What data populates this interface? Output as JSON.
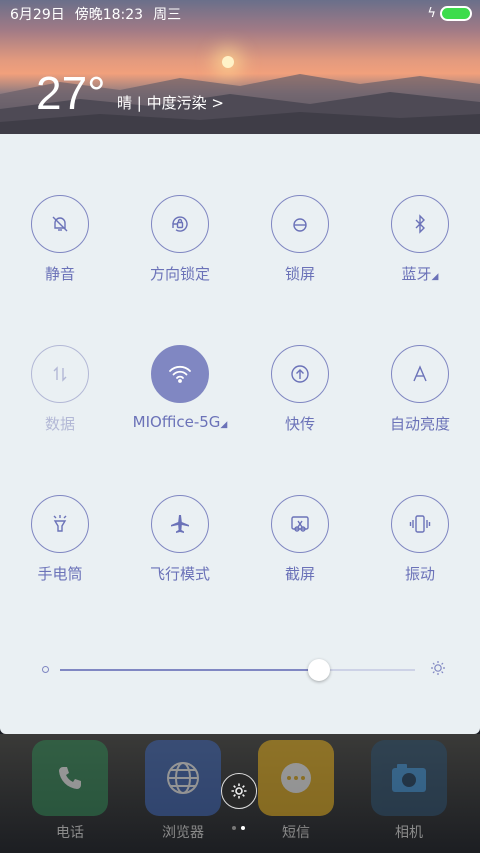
{
  "status": {
    "date": "6月29日",
    "time": "傍晚18:23",
    "weekday": "周三"
  },
  "weather": {
    "temp": "27°",
    "desc": "晴 | 中度污染 >"
  },
  "toggles": [
    {
      "label": "静音",
      "icon": "bell-off-icon",
      "state": "off"
    },
    {
      "label": "方向锁定",
      "icon": "rotation-lock-icon",
      "state": "off"
    },
    {
      "label": "锁屏",
      "icon": "lock-icon",
      "state": "off"
    },
    {
      "label": "蓝牙",
      "icon": "bluetooth-icon",
      "state": "off",
      "expand": "◢"
    },
    {
      "label": "数据",
      "icon": "mobile-data-icon",
      "state": "disabled"
    },
    {
      "label": "MIOffice-5G",
      "icon": "wifi-icon",
      "state": "on",
      "expand": "◢"
    },
    {
      "label": "快传",
      "icon": "upload-icon",
      "state": "off"
    },
    {
      "label": "自动亮度",
      "icon": "auto-brightness-icon",
      "state": "off"
    },
    {
      "label": "手电筒",
      "icon": "flashlight-icon",
      "state": "off"
    },
    {
      "label": "飞行模式",
      "icon": "airplane-icon",
      "state": "off"
    },
    {
      "label": "截屏",
      "icon": "screenshot-icon",
      "state": "off"
    },
    {
      "label": "振动",
      "icon": "vibrate-icon",
      "state": "off"
    }
  ],
  "brightness": {
    "level": 0.73
  },
  "dock": [
    {
      "label": "电话",
      "icon": "phone-icon",
      "color": "#2e7d4f"
    },
    {
      "label": "浏览器",
      "icon": "browser-icon",
      "color": "#3a5ea8"
    },
    {
      "label": "短信",
      "icon": "message-icon",
      "color": "#d4a21c"
    },
    {
      "label": "相机",
      "icon": "camera-icon",
      "color": "#2a4a66"
    }
  ],
  "colors": {
    "accent": "#8087c2",
    "panel": "#eaf0f3"
  }
}
